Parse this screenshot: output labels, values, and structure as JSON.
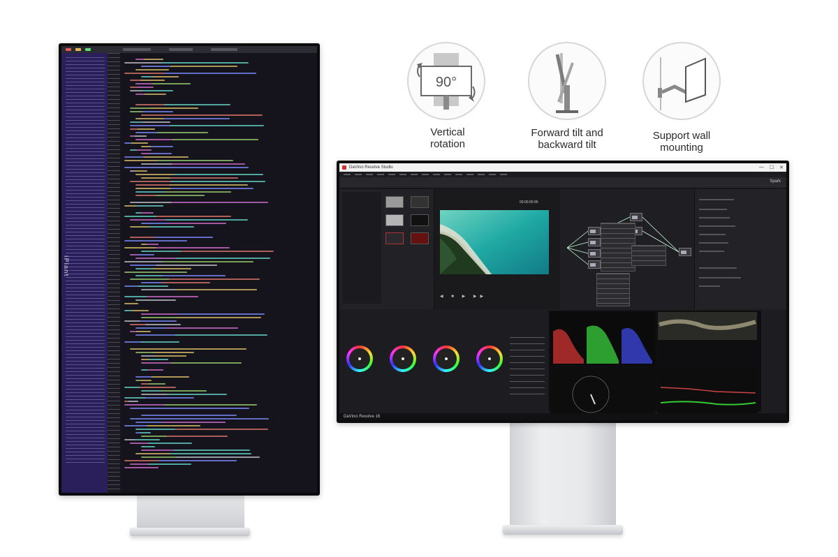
{
  "features": [
    {
      "id": "rotation",
      "label_line1": "Vertical",
      "label_line2": "rotation",
      "icon_text": "90°"
    },
    {
      "id": "tilt",
      "label_line1": "Forward tilt and",
      "label_line2": "backward tilt"
    },
    {
      "id": "wall",
      "label_line1": "Support wall",
      "label_line2": "mounting"
    }
  ],
  "portrait_monitor": {
    "brand": "iPlant"
  },
  "landscape_monitor": {
    "app_title": "DaVinci Resolve Studio",
    "window_buttons": [
      "—",
      "☐",
      "✕"
    ],
    "sparkline_label": "Spark",
    "transport_glyphs": "◀ ■ ▶ ▶▶",
    "timecode": "00:00:00:00",
    "statusbar_label": "DaVinci Resolve 16"
  },
  "colors": {
    "navigator": "#2a1f5a",
    "resolve_bg": "#1b1b1f",
    "label_text": "#2b2b2b"
  }
}
